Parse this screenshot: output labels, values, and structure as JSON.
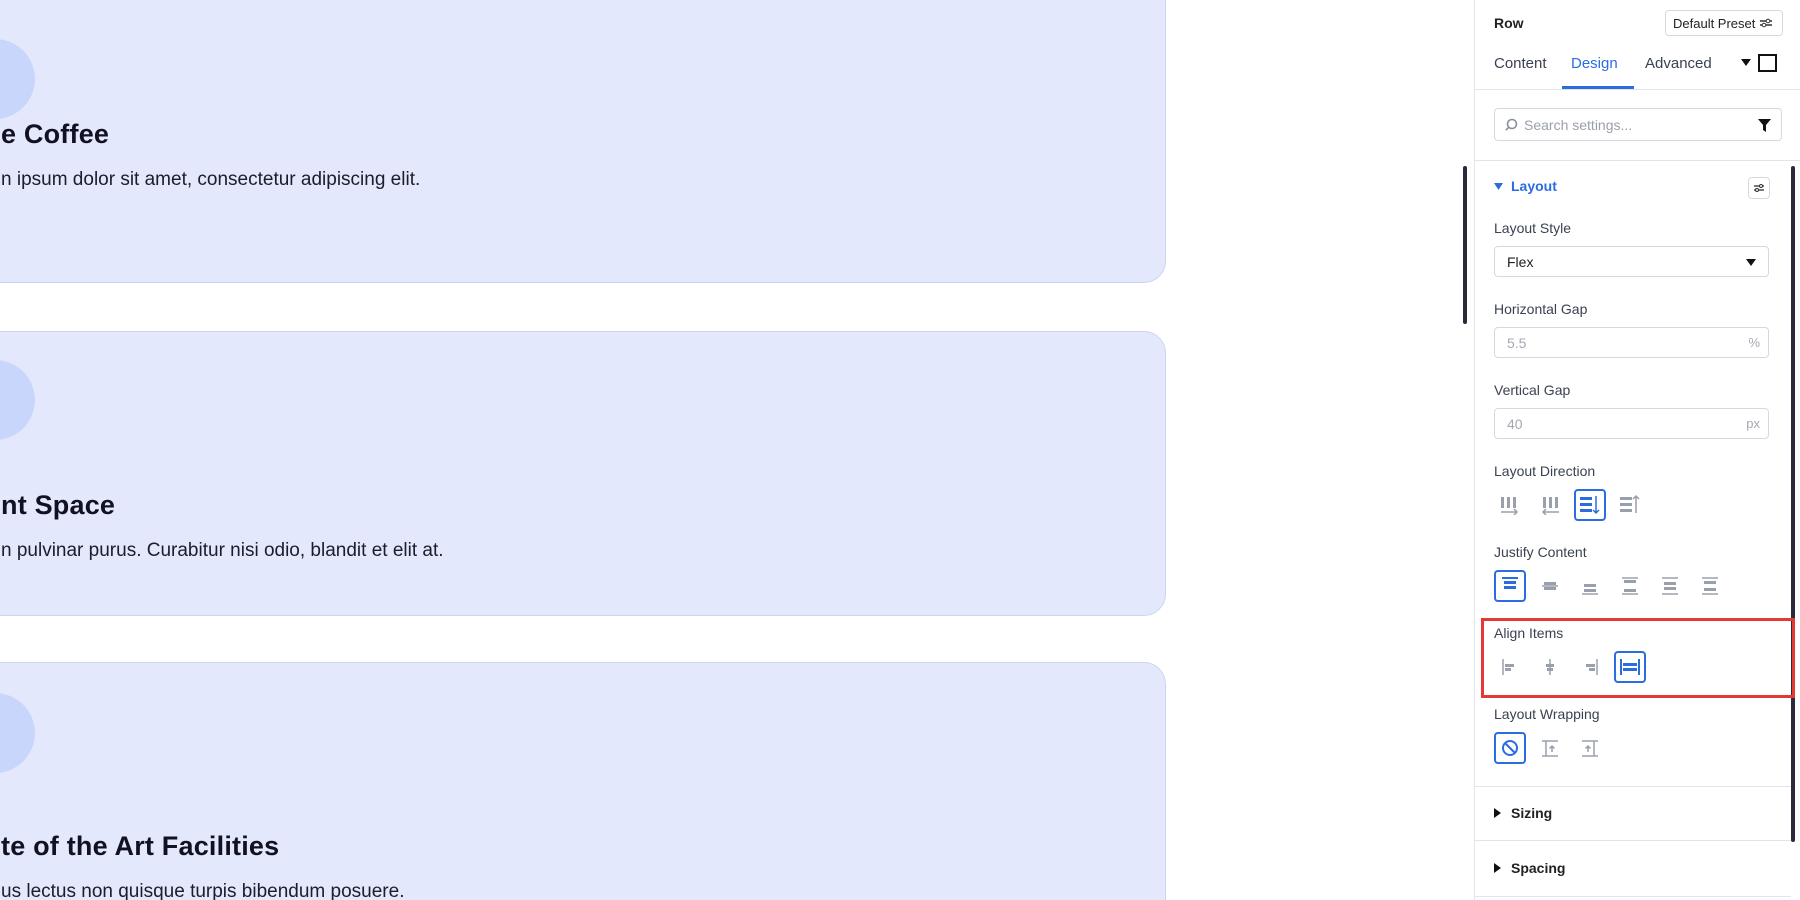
{
  "cards": [
    {
      "title": "e Coffee",
      "text": "n ipsum dolor sit amet, consectetur adipiscing elit.",
      "icon": "coffee-mug-icon"
    },
    {
      "title": "nt Space",
      "text": "n pulvinar purus. Curabitur nisi odio, blandit et elit at.",
      "icon": "tag-icon"
    },
    {
      "title": "te of the Art Facilities",
      "text": "us lectus non quisque turpis bibendum posuere.",
      "icon": "tablet-icon"
    }
  ],
  "panel": {
    "title": "Row",
    "preset_label": "Default Preset",
    "tabs": [
      {
        "label": "Content",
        "active": false
      },
      {
        "label": "Design",
        "active": true
      },
      {
        "label": "Advanced",
        "active": false
      }
    ],
    "search": {
      "placeholder": "Search settings..."
    },
    "section": {
      "label": "Layout"
    },
    "layout_style": {
      "label": "Layout Style",
      "value": "Flex"
    },
    "horizontal_gap": {
      "label": "Horizontal Gap",
      "value": "5.5",
      "unit": "%"
    },
    "vertical_gap": {
      "label": "Vertical Gap",
      "value": "40",
      "unit": "px"
    },
    "layout_direction": {
      "label": "Layout Direction",
      "options": [
        "row",
        "row-reverse",
        "column",
        "column-reverse"
      ],
      "selected": "column"
    },
    "justify_content": {
      "label": "Justify Content",
      "options": [
        "start",
        "center",
        "end",
        "space-between",
        "space-around",
        "space-evenly"
      ],
      "selected": "start"
    },
    "align_items": {
      "label": "Align Items",
      "options": [
        "start",
        "center",
        "end",
        "stretch"
      ],
      "selected": "stretch"
    },
    "layout_wrapping": {
      "label": "Layout Wrapping",
      "options": [
        "no-wrap",
        "wrap",
        "wrap-reverse"
      ],
      "selected": "no-wrap"
    },
    "collapsed_sections": [
      {
        "label": "Sizing"
      },
      {
        "label": "Spacing"
      }
    ]
  },
  "colors": {
    "accent": "#2b6de0",
    "card_bg": "#e3e8fc",
    "highlight": "#e53935"
  }
}
